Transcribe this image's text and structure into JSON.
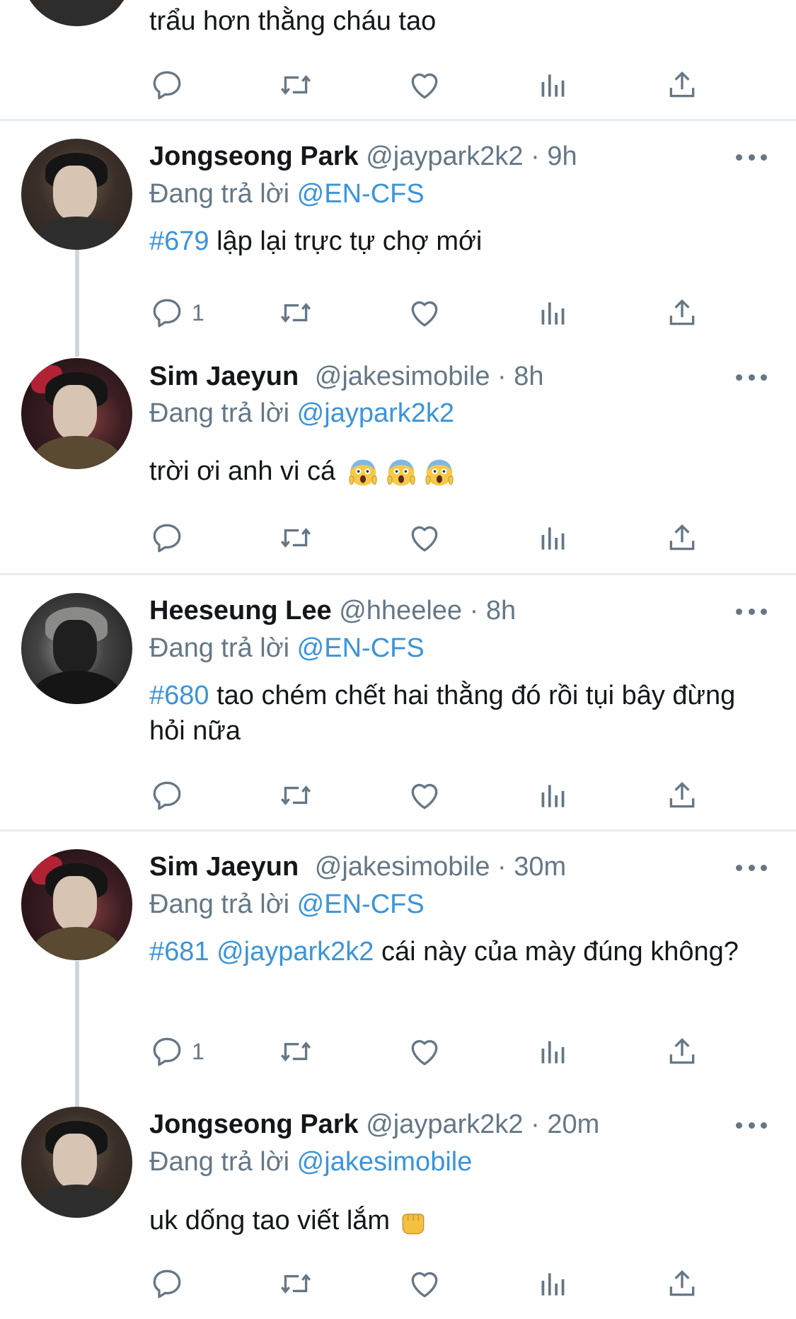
{
  "tweets": [
    {
      "text": "trẩu hơn thằng cháu tao"
    },
    {
      "name": "Jongseong Park",
      "handle": "@jaypark2k2",
      "time": "· 9h",
      "reply_prefix": "Đang trả lời",
      "reply_to": "@EN-CFS",
      "tag": "#679",
      "text": " lập lại trực tự chợ mới",
      "reply_count": "1"
    },
    {
      "name": "Sim Jaeyun",
      "handle": "@jakesimobile",
      "time": "· 8h",
      "reply_prefix": "Đang trả lời",
      "reply_to": "@jaypark2k2",
      "text": "trời ơi anh vi cá "
    },
    {
      "name": "Heeseung Lee",
      "handle": "@hheelee",
      "time": "· 8h",
      "reply_prefix": "Đang trả lời",
      "reply_to": "@EN-CFS",
      "tag": "#680",
      "text": " tao chém chết hai thằng đó rồi tụi bây đừng hỏi nữa"
    },
    {
      "name": "Sim Jaeyun",
      "handle": "@jakesimobile",
      "time": "· 30m",
      "reply_prefix": "Đang trả lời",
      "reply_to": "@EN-CFS",
      "tag": "#681",
      "mention": " @jaypark2k2",
      "text": " cái này của mày đúng không?",
      "reply_count": "1"
    },
    {
      "name": "Jongseong Park",
      "handle": "@jaypark2k2",
      "time": "· 20m",
      "reply_prefix": "Đang trả lời",
      "reply_to": "@jakesimobile",
      "text": "uk dống tao viết lắm "
    }
  ],
  "icons": {
    "reply": "reply-icon",
    "retweet": "retweet-icon",
    "like": "heart-icon",
    "analytics": "analytics-icon",
    "share": "share-icon",
    "more": "more-icon"
  },
  "colors": {
    "link": "#3b94d9",
    "secondary": "#657786",
    "divider": "#e6ecf0"
  }
}
